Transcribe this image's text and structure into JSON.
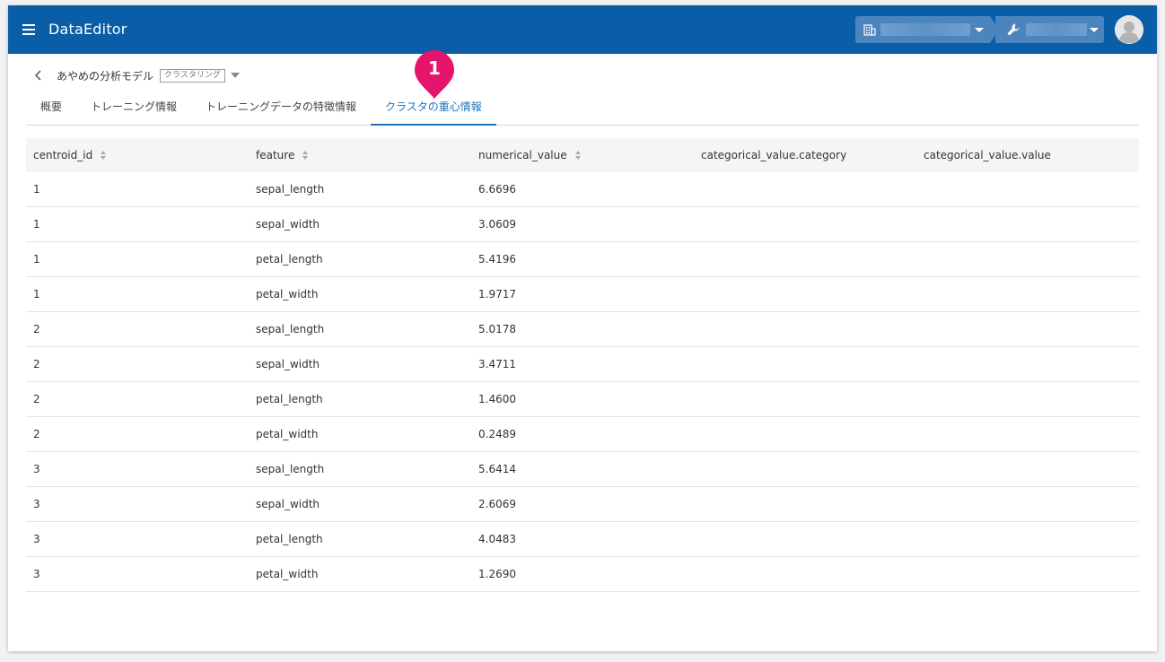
{
  "app": {
    "title": "DataEditor"
  },
  "header": {
    "organization_selector": {
      "value": ""
    },
    "project_selector": {
      "value": ""
    }
  },
  "breadcrumb": {
    "model_name": "あやめの分析モデル",
    "model_type": "クラスタリング"
  },
  "tabs": [
    {
      "label": "概要",
      "active": false
    },
    {
      "label": "トレーニング情報",
      "active": false
    },
    {
      "label": "トレーニングデータの特徴情報",
      "active": false
    },
    {
      "label": "クラスタの重心情報",
      "active": true
    }
  ],
  "callout": {
    "number": "1",
    "color": "#e5156b"
  },
  "table": {
    "columns": [
      {
        "label": "centroid_id",
        "sortable": true
      },
      {
        "label": "feature",
        "sortable": true
      },
      {
        "label": "numerical_value",
        "sortable": true
      },
      {
        "label": "categorical_value.category",
        "sortable": false
      },
      {
        "label": "categorical_value.value",
        "sortable": false
      }
    ],
    "rows": [
      [
        "1",
        "sepal_length",
        "6.6696",
        "",
        ""
      ],
      [
        "1",
        "sepal_width",
        "3.0609",
        "",
        ""
      ],
      [
        "1",
        "petal_length",
        "5.4196",
        "",
        ""
      ],
      [
        "1",
        "petal_width",
        "1.9717",
        "",
        ""
      ],
      [
        "2",
        "sepal_length",
        "5.0178",
        "",
        ""
      ],
      [
        "2",
        "sepal_width",
        "3.4711",
        "",
        ""
      ],
      [
        "2",
        "petal_length",
        "1.4600",
        "",
        ""
      ],
      [
        "2",
        "petal_width",
        "0.2489",
        "",
        ""
      ],
      [
        "3",
        "sepal_length",
        "5.6414",
        "",
        ""
      ],
      [
        "3",
        "sepal_width",
        "2.6069",
        "",
        ""
      ],
      [
        "3",
        "petal_length",
        "4.0483",
        "",
        ""
      ],
      [
        "3",
        "petal_width",
        "1.2690",
        "",
        ""
      ]
    ]
  },
  "colors": {
    "appbar": "#0a5ea8",
    "accent": "#1e73be",
    "selector_bg": "#4c85bd"
  }
}
